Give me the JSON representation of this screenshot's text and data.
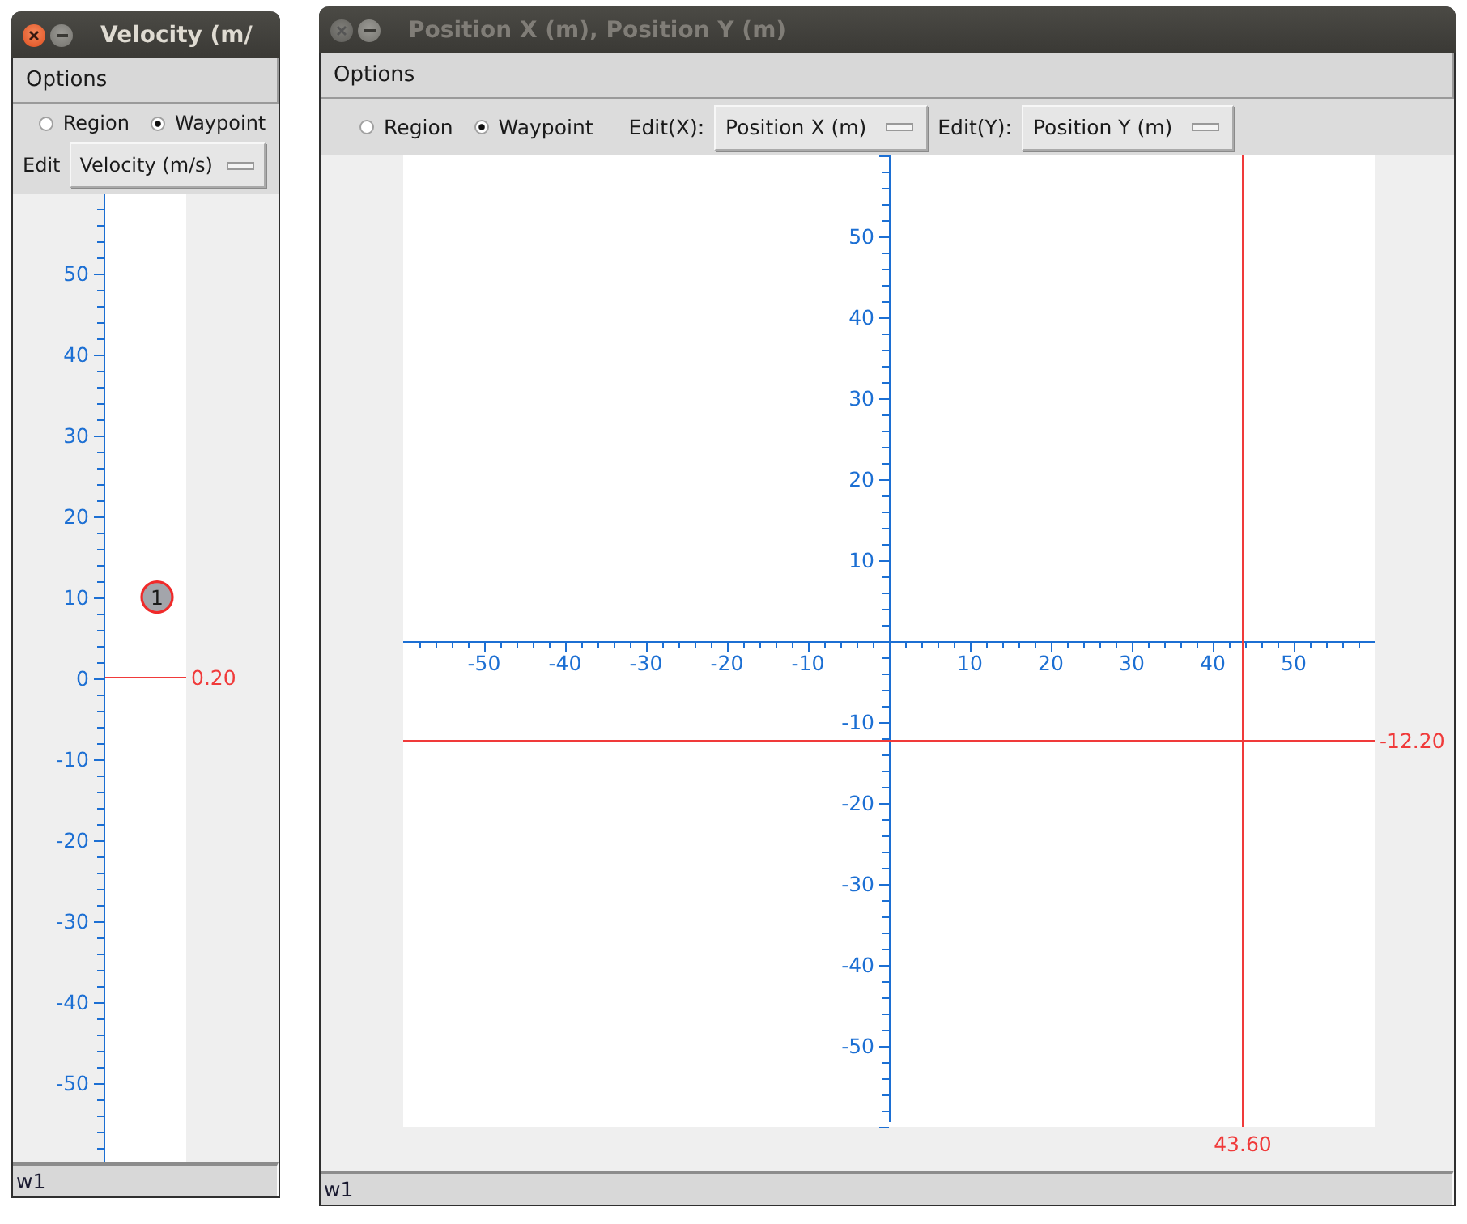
{
  "windows": [
    {
      "title": "Velocity (m/",
      "active": true,
      "menu": [
        "Options"
      ],
      "modes": [
        {
          "label": "Region",
          "selected": false
        },
        {
          "label": "Waypoint",
          "selected": true
        }
      ],
      "editors": [
        {
          "label": "Edit",
          "value": "Velocity (m/s)"
        }
      ],
      "plot": {
        "kind": "strip",
        "y_ticks": [
          "50",
          "40",
          "30",
          "20",
          "10",
          "0",
          "-10",
          "-20",
          "-30",
          "-40",
          "-50"
        ],
        "waypoints": [
          {
            "label": "1",
            "level": 0.584
          }
        ],
        "cursors": [
          {
            "kind": "horizontal",
            "label": "0.20"
          }
        ]
      },
      "status_bar": "w1"
    },
    {
      "title": "Position X (m), Position Y (m)",
      "active": false,
      "menu": [
        "Options"
      ],
      "modes": [
        {
          "label": "Region",
          "selected": false
        },
        {
          "label": "Waypoint",
          "selected": true
        }
      ],
      "editors": [
        {
          "label": "Edit(X):",
          "value": "Position X (m)"
        },
        {
          "label": "Edit(Y):",
          "value": "Position Y (m)"
        }
      ],
      "plot": {
        "kind": "plane",
        "y_ticks": [
          "50",
          "40",
          "30",
          "20",
          "10",
          "-10",
          "-20",
          "-30",
          "-40",
          "-50"
        ],
        "x_ticks": [
          "-50",
          "-40",
          "-30",
          "-20",
          "-10",
          "10",
          "20",
          "30",
          "40",
          "50"
        ],
        "cursors": [
          {
            "kind": "horizontal",
            "label": "-12.20"
          },
          {
            "kind": "vertical",
            "label": "43.60"
          }
        ]
      },
      "status_bar": "w1"
    }
  ]
}
